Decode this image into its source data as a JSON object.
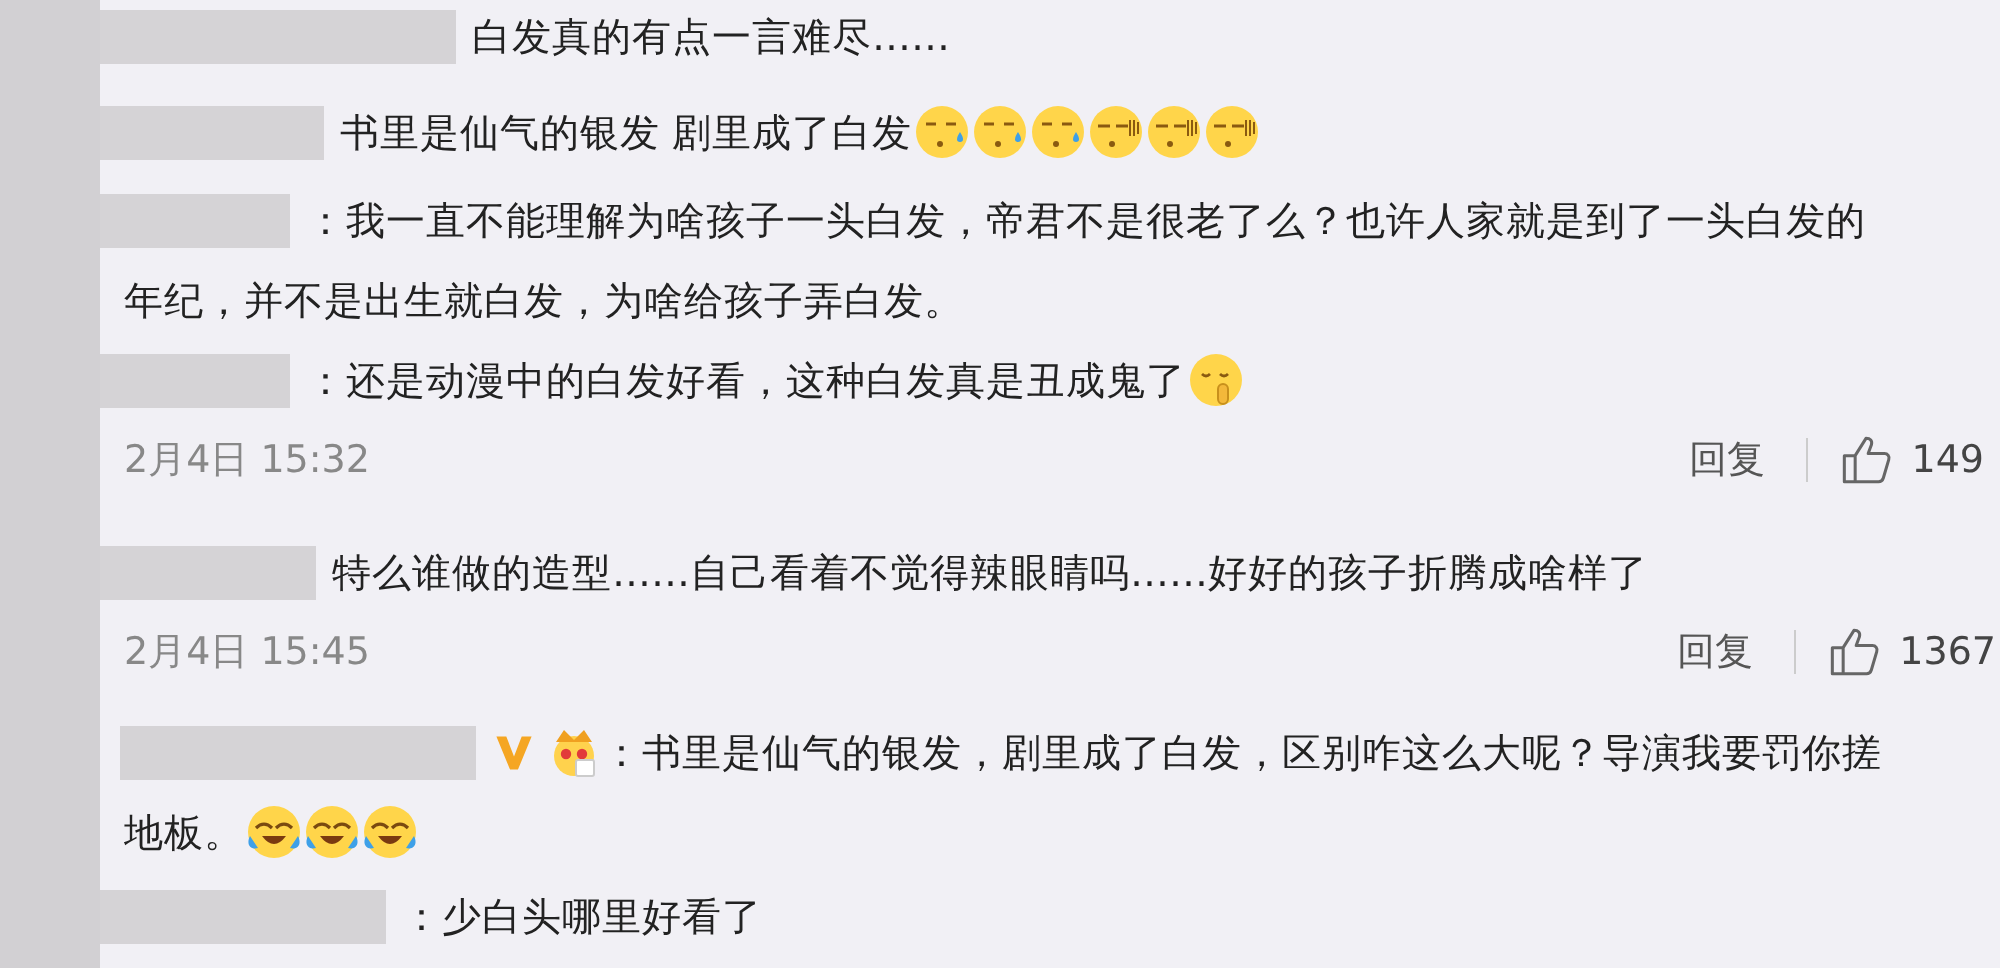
{
  "items": [
    {
      "kind": "comment",
      "lines": [
        "白发真的有点一言难尽……"
      ]
    },
    {
      "kind": "comment",
      "lines": [
        "书里是仙气的银发 剧里成了白发"
      ],
      "emojis": [
        {
          "kind": "sweat"
        },
        {
          "kind": "sweat"
        },
        {
          "kind": "sweat"
        },
        {
          "kind": "speechless"
        },
        {
          "kind": "speechless"
        },
        {
          "kind": "speechless"
        }
      ]
    },
    {
      "kind": "comment",
      "lines": [
        "：我一直不能理解为啥孩子一头白发，帝君不是很老了么？也许人家就是到了一头白发的",
        "年纪，并不是出生就白发，为啥给孩子弄白发。"
      ]
    },
    {
      "kind": "comment",
      "lines": [
        "：还是动漫中的白发好看，这种白发真是丑成鬼了"
      ],
      "emojis": [
        {
          "kind": "shush"
        }
      ]
    },
    {
      "kind": "meta",
      "date": "2月4日 15:32",
      "reply": "回复",
      "likes": "149"
    },
    {
      "kind": "comment",
      "lines": [
        "特么谁做的造型……自己看着不觉得辣眼睛吗……好好的孩子折腾成啥样了"
      ]
    },
    {
      "kind": "meta",
      "date": "2月4日 15:45",
      "reply": "回复",
      "likes": "1367"
    },
    {
      "kind": "comment",
      "verified": true,
      "badges": [
        {
          "kind": "crown"
        }
      ],
      "lines": [
        "：书里是仙气的银发，剧里成了白发，区别咋这么大呢？导演我要罚你搓",
        "地板。"
      ],
      "emojis": [
        {
          "kind": "laugh-cry"
        },
        {
          "kind": "laugh-cry"
        },
        {
          "kind": "laugh-cry"
        }
      ]
    },
    {
      "kind": "comment",
      "lines": [
        "：少白头哪里好看了"
      ]
    }
  ]
}
